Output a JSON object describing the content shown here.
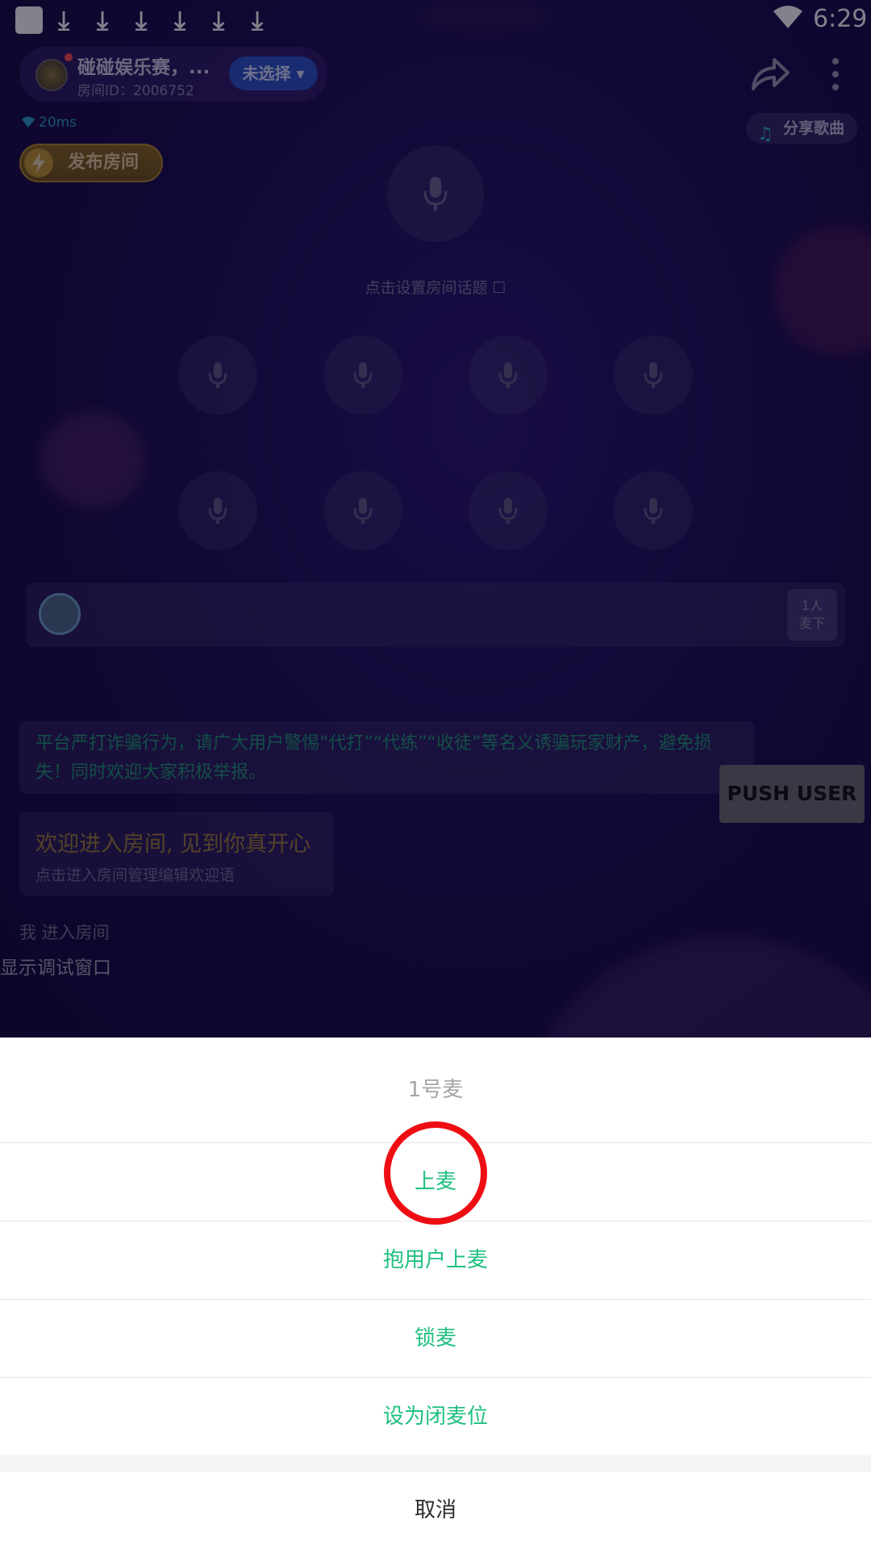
{
  "status_bar": {
    "time": "6:29",
    "download_icons": [
      "download-icon",
      "download-icon",
      "download-icon",
      "download-icon",
      "download-icon",
      "download-icon"
    ]
  },
  "room": {
    "name": "碰碰娱乐赛，...",
    "id_text": "房间ID：2006752",
    "select_label": "未选择 ▾",
    "ping": "20ms",
    "share_song": "分享歌曲",
    "publish": "发布房间",
    "topic": "点击设置房间话题 ☐"
  },
  "users_bar": {
    "count_line1": "1人",
    "count_line2": "麦下"
  },
  "chat": {
    "notice": "平台严打诈骗行为，请广大用户警惕“代打”“代练”“收徒”等名义诱骗玩家财产，避免损失！同时欢迎大家积极举报。",
    "welcome_title": "欢迎进入房间, 见到你真开心",
    "welcome_sub": "点击进入房间管理编辑欢迎语",
    "enter_msg": "我 进入房间"
  },
  "debug_label": "显示调试窗口",
  "push_button": "PUSH USER",
  "sheet": {
    "title": "1号麦",
    "options": [
      "上麦",
      "抱用户上麦",
      "锁麦",
      "设为闭麦位"
    ],
    "cancel": "取消"
  },
  "colors": {
    "accent_green": "#20c07f",
    "highlight_red": "#ee0d12",
    "select_blue": "#2a55c9"
  }
}
